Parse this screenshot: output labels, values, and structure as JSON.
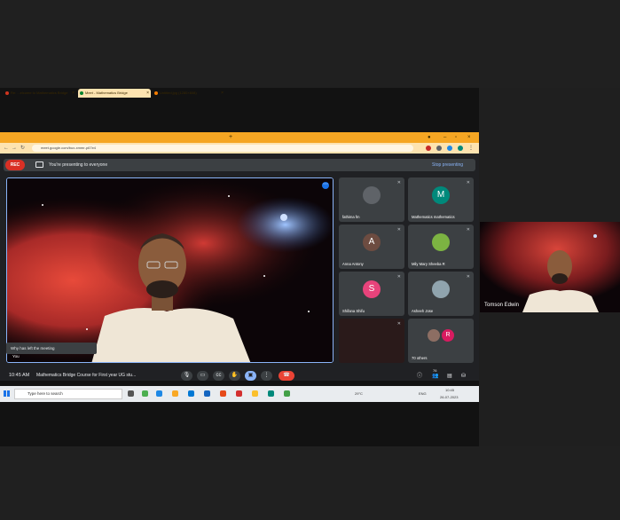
{
  "browser": {
    "tabs": [
      {
        "label": "Re: ...elcome to Mathematics Bridge",
        "active": false
      },
      {
        "label": "Meet - Mathematics Bridge",
        "active": true
      },
      {
        "label": "Untitled.jpg (1280×608)",
        "active": false
      }
    ],
    "new_tab": "+",
    "url": "meet.google.com/bux-xmmr-p67e4"
  },
  "meet": {
    "rec_label": "REC",
    "presenting_text": "You're presenting to everyone",
    "stop_presenting": "Stop presenting",
    "popup_text": "Why has left the meeting",
    "you_label": "You",
    "time": "10:45 AM",
    "meeting_title": "Mathematics Bridge Course for First year UG stu...",
    "participants": [
      {
        "name": "fathima fm",
        "initial": "",
        "color": "#5f6368"
      },
      {
        "name": "Mathematics mathematics",
        "initial": "M",
        "color": "#00897b"
      },
      {
        "name": "Anna Antony",
        "initial": "A",
        "color": "#6d4c41"
      },
      {
        "name": "Mily Mary Sheeba R",
        "initial": "",
        "color": "#7cb342"
      },
      {
        "name": "Shifana Shifu",
        "initial": "S",
        "color": "#e8437b"
      },
      {
        "name": "Asheeh Jose",
        "initial": "",
        "color": "#90a4ae"
      },
      {
        "name": "",
        "initial": "",
        "color": "#2a1a1a"
      },
      {
        "name": "70 others",
        "initial": "R",
        "color": "#d81b60"
      }
    ],
    "participant_count": "76"
  },
  "taskbar": {
    "search_placeholder": "Type here to search",
    "weather": "29°C",
    "lang": "ENG",
    "clock_time": "10:45",
    "clock_date": "26-07-2023"
  },
  "side_tile": {
    "name": "Tomson Edwin"
  }
}
